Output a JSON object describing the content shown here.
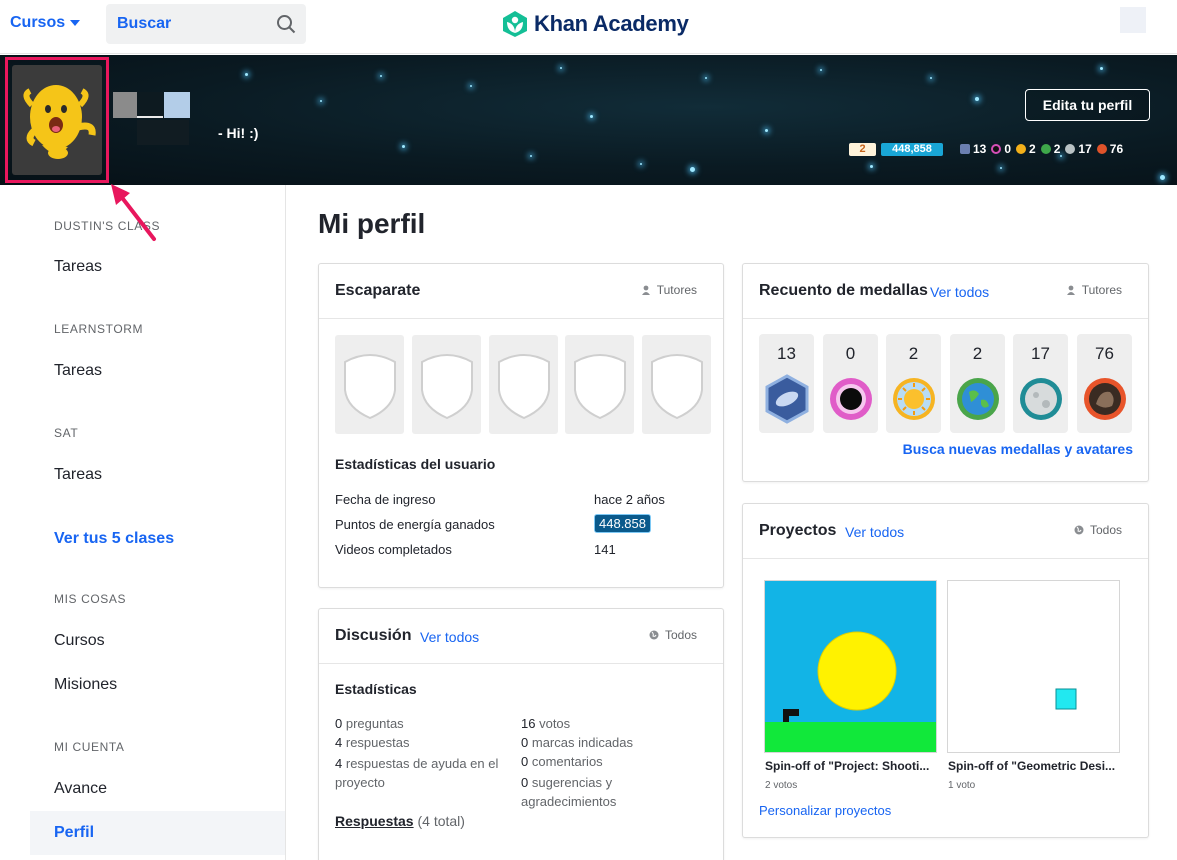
{
  "nav": {
    "courses_label": "Cursos",
    "search_placeholder": "Buscar",
    "logo_text": "Khan Academy"
  },
  "banner": {
    "bio": "- Hi! :)",
    "edit_profile_label": "Edita tu perfil",
    "level": "2",
    "points": "448,858",
    "badge_counts": [
      {
        "icon": "meteorite-badge-icon",
        "count": "13",
        "color": "#6b7fb0"
      },
      {
        "icon": "black-hole-badge-icon",
        "count": "0",
        "color": "#d64fb8"
      },
      {
        "icon": "sun-badge-icon",
        "count": "2",
        "color": "#f3b01a"
      },
      {
        "icon": "earth-badge-icon",
        "count": "2",
        "color": "#3ea84a"
      },
      {
        "icon": "moon-badge-icon",
        "count": "17",
        "color": "#b9c2c4"
      },
      {
        "icon": "challenge-patch-icon",
        "count": "76",
        "color": "#e0532a"
      }
    ]
  },
  "sidebar": {
    "sections": [
      {
        "heading": "DUSTIN'S CLASS",
        "link": "Tareas"
      },
      {
        "heading": "LEARNSTORM",
        "link": "Tareas"
      },
      {
        "heading": "SAT",
        "link": "Tareas"
      }
    ],
    "all_classes": "Ver tus 5 clases",
    "my_stuff_heading": "MIS COSAS",
    "my_stuff_links": [
      "Cursos",
      "Misiones"
    ],
    "account_heading": "MI CUENTA",
    "account_links": [
      "Avance",
      "Perfil"
    ]
  },
  "main": {
    "title": "Mi perfil",
    "showcase": {
      "title": "Escaparate",
      "visibility": "Tutores",
      "stats_heading": "Estadísticas del usuario",
      "stats": [
        {
          "label": "Fecha de ingreso",
          "value": "hace 2 años"
        },
        {
          "label": "Puntos de energía ganados",
          "value": "448.858"
        },
        {
          "label": "Videos completados",
          "value": "141"
        }
      ]
    },
    "badges": {
      "title": "Recuento de medallas",
      "view_all": "Ver todos",
      "visibility": "Tutores",
      "counts": [
        "13",
        "0",
        "2",
        "2",
        "17",
        "76"
      ],
      "find_link": "Busca nuevas medallas y avatares"
    },
    "discussion": {
      "title": "Discusión",
      "view_all": "Ver todos",
      "visibility": "Todos",
      "stats_heading": "Estadísticas",
      "left": [
        {
          "num": "0",
          "text": "preguntas"
        },
        {
          "num": "4",
          "text": "respuestas"
        },
        {
          "num": "4",
          "text": "respuestas de ayuda en el proyecto"
        }
      ],
      "right": [
        {
          "num": "16",
          "text": "votos"
        },
        {
          "num": "0",
          "text": "marcas indicadas"
        },
        {
          "num": "0",
          "text": "comentarios"
        },
        {
          "num": "0",
          "text": "sugerencias y agradecimientos"
        }
      ],
      "answers_link": "Respuestas",
      "answers_total": "(4 total)"
    },
    "projects": {
      "title": "Proyectos",
      "view_all": "Ver todos",
      "visibility": "Todos",
      "items": [
        {
          "title": "Spin-off of \"Project: Shooti...",
          "votes": "2 votos"
        },
        {
          "title": "Spin-off of \"Geometric Desi...",
          "votes": "1 voto"
        }
      ],
      "customize_link": "Personalizar proyectos"
    }
  }
}
